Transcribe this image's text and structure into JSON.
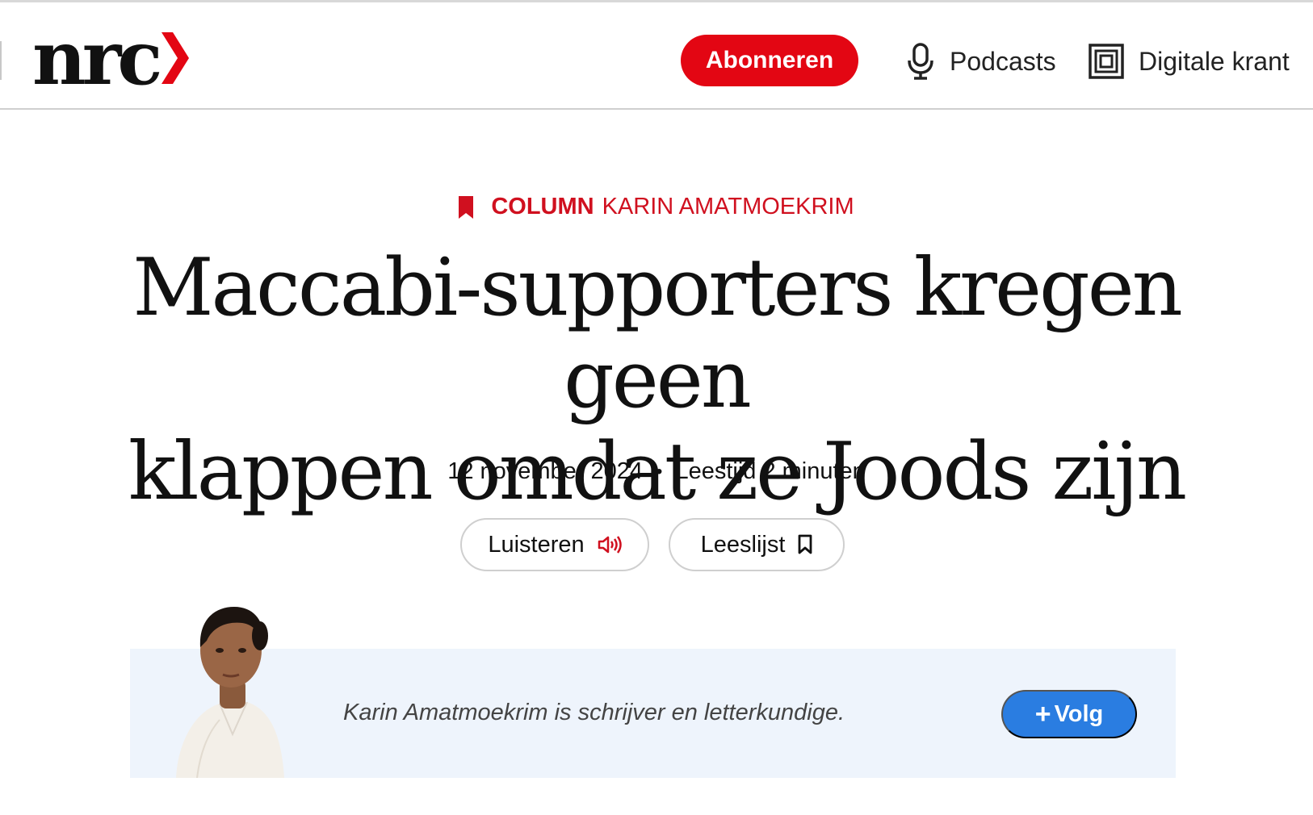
{
  "header": {
    "logo_text": "nrc",
    "subscribe_label": "Abonneren",
    "podcasts_label": "Podcasts",
    "krant_label": "Digitale krant"
  },
  "article": {
    "kicker_type": "COLUMN",
    "kicker_author": "KARIN AMATMOEKRIM",
    "headline_line1": "Maccabi-supporters kregen geen",
    "headline_line2": "klappen omdat ze Joods zijn",
    "date": "12 november 2024",
    "separator": "•",
    "reading_time": "Leestijd 2 minuten",
    "listen_label": "Luisteren",
    "readlist_label": "Leeslijst"
  },
  "author": {
    "bio": "Karin Amatmoekrim is schrijver en letterkundige.",
    "follow_plus": "+",
    "follow_label": "Volg"
  },
  "colors": {
    "brand_red": "#e30613",
    "follow_blue": "#2a7de1",
    "author_box_bg": "#eef4fc"
  },
  "icons": [
    "nrc-chevron-icon",
    "microphone-icon",
    "newspaper-icon",
    "bookmark-filled-icon",
    "speaker-icon",
    "bookmark-outline-icon",
    "plus-icon"
  ]
}
